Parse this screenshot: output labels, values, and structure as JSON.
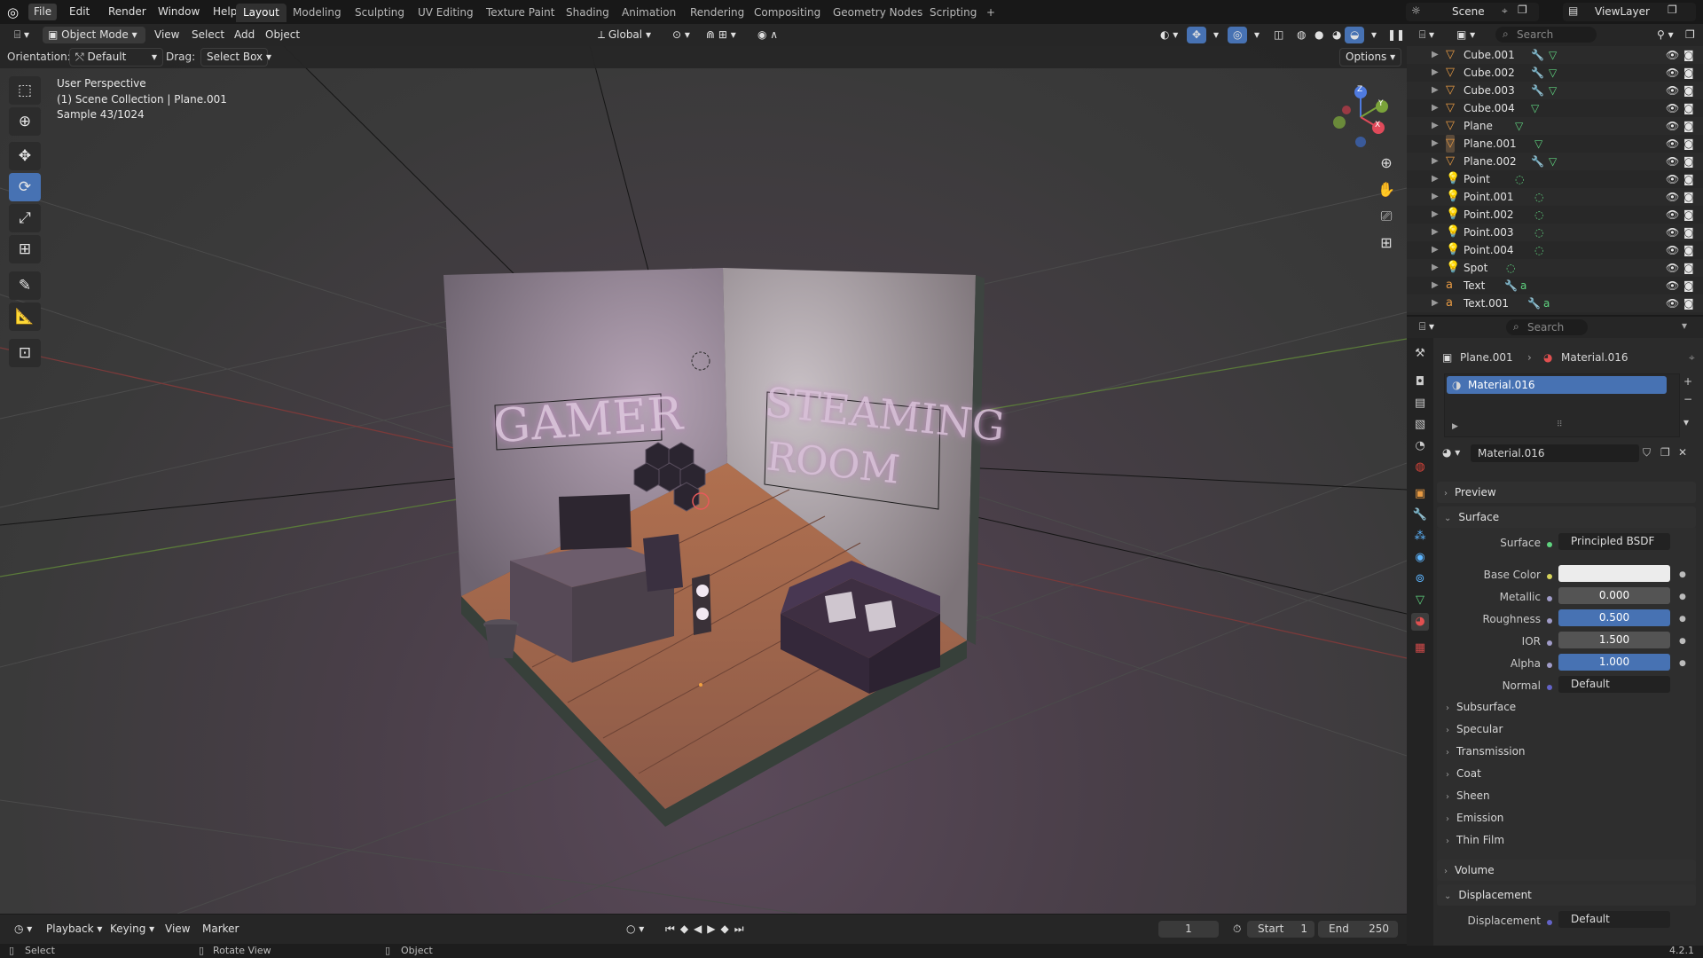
{
  "topbar": {
    "menus": [
      "File",
      "Edit",
      "Render",
      "Window",
      "Help"
    ],
    "workspaces": [
      "Layout",
      "Modeling",
      "Sculpting",
      "UV Editing",
      "Texture Paint",
      "Shading",
      "Animation",
      "Rendering",
      "Compositing",
      "Geometry Nodes",
      "Scripting"
    ],
    "active_workspace": "Layout",
    "add_tab": "+",
    "scene": "Scene",
    "view_layer": "ViewLayer"
  },
  "viewport_header": {
    "mode": "Object Mode",
    "menus": [
      "View",
      "Select",
      "Add",
      "Object"
    ],
    "transform_orientation": "Global"
  },
  "tool_settings": {
    "orientation_label": "Orientation:",
    "orientation_value": "Default",
    "drag_label": "Drag:",
    "drag_value": "Select Box",
    "options": "Options"
  },
  "viewport_overlay": {
    "view_name": "User Perspective",
    "collection": "(1) Scene Collection | Plane.001",
    "sample": "Sample 43/1024"
  },
  "scene_text": {
    "sign_left": "GAMER",
    "sign_right_1": "STEAMING",
    "sign_right_2": "ROOM"
  },
  "gizmo": {
    "x": "X",
    "y": "Y",
    "z": "Z"
  },
  "outliner": {
    "search_placeholder": "Search",
    "items": [
      {
        "name": "Cube.001",
        "icon": "mesh-icon"
      },
      {
        "name": "Cube.002",
        "icon": "mesh-icon"
      },
      {
        "name": "Cube.003",
        "icon": "mesh-icon"
      },
      {
        "name": "Cube.004",
        "icon": "mesh-icon"
      },
      {
        "name": "Plane",
        "icon": "mesh-icon"
      },
      {
        "name": "Plane.001",
        "icon": "mesh-icon"
      },
      {
        "name": "Plane.002",
        "icon": "mesh-icon"
      },
      {
        "name": "Point",
        "icon": "light-icon"
      },
      {
        "name": "Point.001",
        "icon": "light-icon"
      },
      {
        "name": "Point.002",
        "icon": "light-icon"
      },
      {
        "name": "Point.003",
        "icon": "light-icon"
      },
      {
        "name": "Point.004",
        "icon": "light-icon"
      },
      {
        "name": "Spot",
        "icon": "light-icon"
      },
      {
        "name": "Text",
        "icon": "text-icon"
      },
      {
        "name": "Text.001",
        "icon": "text-icon"
      }
    ]
  },
  "properties": {
    "search_placeholder": "Search",
    "breadcrumb_object": "Plane.001",
    "breadcrumb_material": "Material.016",
    "slot_name": "Material.016",
    "material_name": "Material.016",
    "preview": "Preview",
    "surface_panel": "Surface",
    "surface_label": "Surface",
    "surface_value": "Principled BSDF",
    "fields": [
      {
        "label": "Base Color",
        "value": "",
        "style": "white"
      },
      {
        "label": "Metallic",
        "value": "0.000",
        "style": "grey"
      },
      {
        "label": "Roughness",
        "value": "0.500",
        "style": "blue"
      },
      {
        "label": "IOR",
        "value": "1.500",
        "style": "grey"
      },
      {
        "label": "Alpha",
        "value": "1.000",
        "style": "blue"
      },
      {
        "label": "Normal",
        "value": "Default",
        "style": "dark"
      }
    ],
    "subpanels": [
      "Subsurface",
      "Specular",
      "Transmission",
      "Coat",
      "Sheen",
      "Emission",
      "Thin Film"
    ],
    "volume": "Volume",
    "displacement_panel": "Displacement",
    "displacement_label": "Displacement",
    "displacement_value": "Default"
  },
  "timeline": {
    "menus": [
      "Playback",
      "Keying",
      "View",
      "Marker"
    ],
    "current_frame": "1",
    "start_label": "Start",
    "start": "1",
    "end_label": "End",
    "end": "250"
  },
  "statusbar": {
    "select": "Select",
    "rotate": "Rotate View",
    "object": "Object",
    "version": "4.2.1"
  },
  "colors": {
    "accent": "#4772b3",
    "header": "#262626",
    "active_object": "#e79a43"
  }
}
